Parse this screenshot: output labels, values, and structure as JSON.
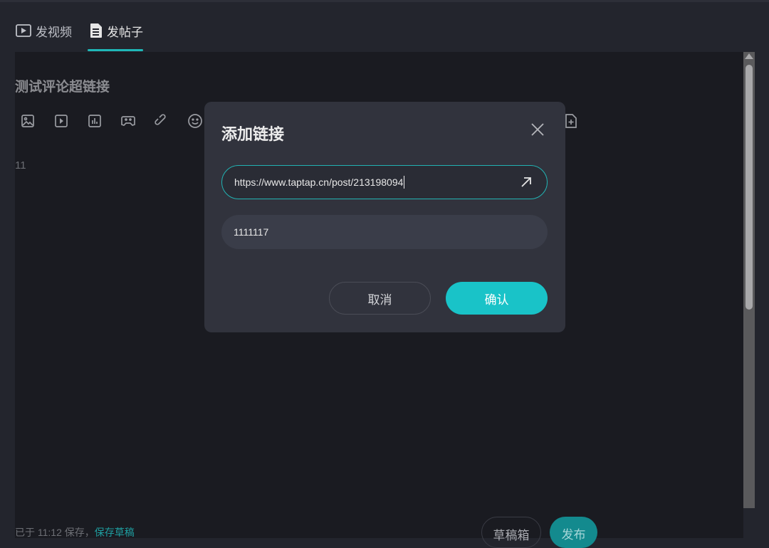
{
  "tabs": [
    {
      "label": "发视频",
      "icon": "play-square-icon"
    },
    {
      "label": "发帖子",
      "icon": "document-icon",
      "active": true
    }
  ],
  "editor": {
    "title": "测试评论超链接",
    "body": "11",
    "toolbar": [
      "image-icon",
      "video-icon",
      "chart-icon",
      "gamepad-icon",
      "link-icon",
      "emoji-icon",
      "file-plus-icon"
    ]
  },
  "footer": {
    "saved_text": "已于 11:12 保存，",
    "save_draft_link": "保存草稿",
    "drafts_button": "草稿箱",
    "publish_button": "发布"
  },
  "dialog": {
    "title": "添加链接",
    "url_value": "https://www.taptap.cn/post/213198094",
    "text_value": "1111117",
    "cancel_label": "取消",
    "confirm_label": "确认"
  },
  "colors": {
    "accent": "#19c3c8",
    "background": "#1a1b21",
    "dialog": "#31333d"
  }
}
